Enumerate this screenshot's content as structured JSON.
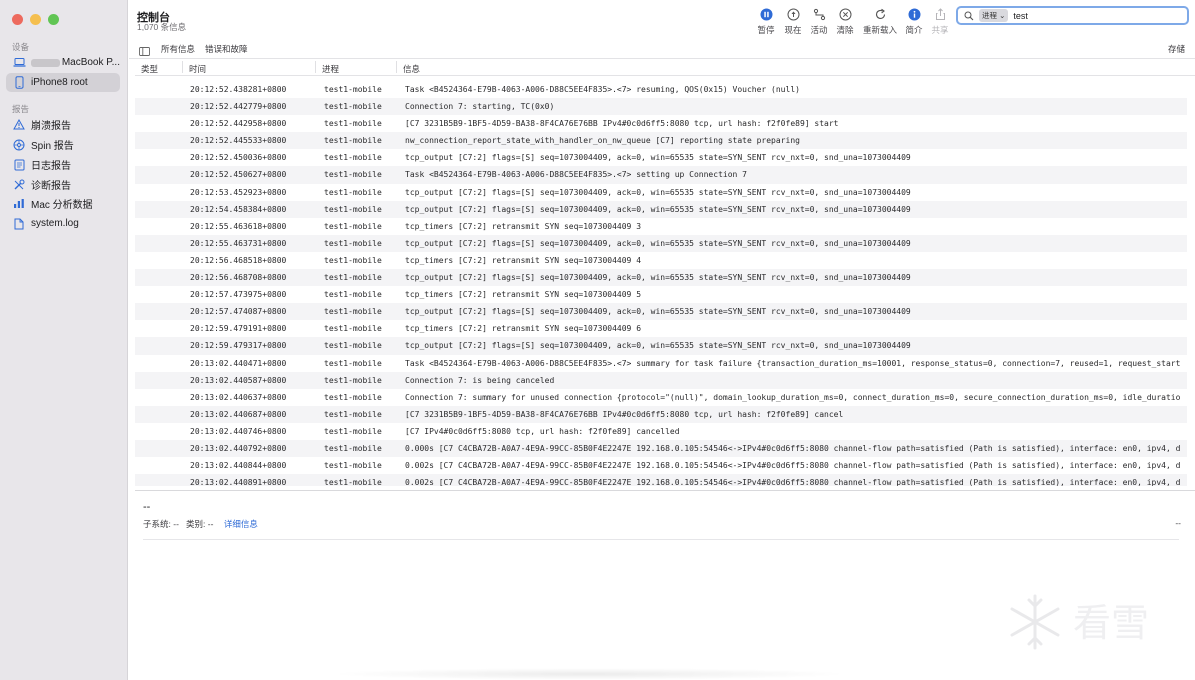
{
  "window": {
    "title": "控制台",
    "subtitle": "1,070 条信息"
  },
  "sidebar": {
    "devices_heading": "设备",
    "devices": [
      {
        "label": "MacBook P...",
        "icon": "laptop-icon"
      },
      {
        "label": "iPhone8 root",
        "icon": "iphone-icon",
        "selected": true
      }
    ],
    "reports_heading": "报告",
    "reports": [
      {
        "label": "崩溃报告",
        "icon": "warning-icon"
      },
      {
        "label": "Spin 报告",
        "icon": "spin-icon"
      },
      {
        "label": "日志报告",
        "icon": "log-report-icon"
      },
      {
        "label": "诊断报告",
        "icon": "tools-icon"
      },
      {
        "label": "Mac 分析数据",
        "icon": "analytics-icon"
      },
      {
        "label": "system.log",
        "icon": "document-icon"
      }
    ]
  },
  "toolbar": {
    "pause": "暂停",
    "now": "现在",
    "activity": "活动",
    "clear": "清除",
    "reload": "重新载入",
    "info": "简介",
    "share": "共享"
  },
  "search": {
    "token": "进程",
    "value": "test"
  },
  "filterbar": {
    "all": "所有信息",
    "errors": "错误和故障",
    "save": "存储"
  },
  "columns": {
    "type": "类型",
    "time": "时间",
    "process": "进程",
    "message": "信息"
  },
  "logs": [
    {
      "time": "20:12:52.438281+0800",
      "process": "test1-mobile",
      "message": "Task <B4524364-E79B-4063-A006-D88C5EE4F835>.<7> resuming, QOS(0x15) Voucher (null)"
    },
    {
      "time": "20:12:52.442779+0800",
      "process": "test1-mobile",
      "message": "Connection 7: starting, TC(0x0)"
    },
    {
      "time": "20:12:52.442958+0800",
      "process": "test1-mobile",
      "message": "[C7 3231B5B9-1BF5-4D59-BA38-8F4CA76E76BB IPv4#0c0d6ff5:8080 tcp, url hash: f2f0fe89] start"
    },
    {
      "time": "20:12:52.445533+0800",
      "process": "test1-mobile",
      "message": "nw_connection_report_state_with_handler_on_nw_queue [C7] reporting state preparing"
    },
    {
      "time": "20:12:52.450036+0800",
      "process": "test1-mobile",
      "message": "tcp_output [C7:2] flags=[S] seq=1073004409, ack=0, win=65535 state=SYN_SENT rcv_nxt=0, snd_una=1073004409"
    },
    {
      "time": "20:12:52.450627+0800",
      "process": "test1-mobile",
      "message": "Task <B4524364-E79B-4063-A006-D88C5EE4F835>.<7> setting up Connection 7"
    },
    {
      "time": "20:12:53.452923+0800",
      "process": "test1-mobile",
      "message": "tcp_output [C7:2] flags=[S] seq=1073004409, ack=0, win=65535 state=SYN_SENT rcv_nxt=0, snd_una=1073004409"
    },
    {
      "time": "20:12:54.458384+0800",
      "process": "test1-mobile",
      "message": "tcp_output [C7:2] flags=[S] seq=1073004409, ack=0, win=65535 state=SYN_SENT rcv_nxt=0, snd_una=1073004409"
    },
    {
      "time": "20:12:55.463618+0800",
      "process": "test1-mobile",
      "message": "tcp_timers [C7:2] retransmit SYN seq=1073004409 3"
    },
    {
      "time": "20:12:55.463731+0800",
      "process": "test1-mobile",
      "message": "tcp_output [C7:2] flags=[S] seq=1073004409, ack=0, win=65535 state=SYN_SENT rcv_nxt=0, snd_una=1073004409"
    },
    {
      "time": "20:12:56.468518+0800",
      "process": "test1-mobile",
      "message": "tcp_timers [C7:2] retransmit SYN seq=1073004409 4"
    },
    {
      "time": "20:12:56.468708+0800",
      "process": "test1-mobile",
      "message": "tcp_output [C7:2] flags=[S] seq=1073004409, ack=0, win=65535 state=SYN_SENT rcv_nxt=0, snd_una=1073004409"
    },
    {
      "time": "20:12:57.473975+0800",
      "process": "test1-mobile",
      "message": "tcp_timers [C7:2] retransmit SYN seq=1073004409 5"
    },
    {
      "time": "20:12:57.474087+0800",
      "process": "test1-mobile",
      "message": "tcp_output [C7:2] flags=[S] seq=1073004409, ack=0, win=65535 state=SYN_SENT rcv_nxt=0, snd_una=1073004409"
    },
    {
      "time": "20:12:59.479191+0800",
      "process": "test1-mobile",
      "message": "tcp_timers [C7:2] retransmit SYN seq=1073004409 6"
    },
    {
      "time": "20:12:59.479317+0800",
      "process": "test1-mobile",
      "message": "tcp_output [C7:2] flags=[S] seq=1073004409, ack=0, win=65535 state=SYN_SENT rcv_nxt=0, snd_una=1073004409"
    },
    {
      "time": "20:13:02.440471+0800",
      "process": "test1-mobile",
      "message": "Task <B4524364-E79B-4063-A006-D88C5EE4F835>.<7> summary for task failure {transaction_duration_ms=10001, response_status=0, connection=7, reused=1, request_start"
    },
    {
      "time": "20:13:02.440587+0800",
      "process": "test1-mobile",
      "message": "Connection 7: is being canceled"
    },
    {
      "time": "20:13:02.440637+0800",
      "process": "test1-mobile",
      "message": "Connection 7: summary for unused connection {protocol=\"(null)\", domain_lookup_duration_ms=0, connect_duration_ms=0, secure_connection_duration_ms=0, idle_duratio"
    },
    {
      "time": "20:13:02.440687+0800",
      "process": "test1-mobile",
      "message": "[C7 3231B5B9-1BF5-4D59-BA38-8F4CA76E76BB IPv4#0c0d6ff5:8080 tcp, url hash: f2f0fe89] cancel"
    },
    {
      "time": "20:13:02.440746+0800",
      "process": "test1-mobile",
      "message": "[C7 IPv4#0c0d6ff5:8080 tcp, url hash: f2f0fe89] cancelled"
    },
    {
      "time": "20:13:02.440792+0800",
      "process": "test1-mobile",
      "message": "0.000s [C7 C4CBA72B-A0A7-4E9A-99CC-85B0F4E2247E 192.168.0.105:54546<->IPv4#0c0d6ff5:8080 channel-flow path=satisfied (Path is satisfied), interface: en0, ipv4, d"
    },
    {
      "time": "20:13:02.440844+0800",
      "process": "test1-mobile",
      "message": "0.002s [C7 C4CBA72B-A0A7-4E9A-99CC-85B0F4E2247E 192.168.0.105:54546<->IPv4#0c0d6ff5:8080 channel-flow path=satisfied (Path is satisfied), interface: en0, ipv4, d"
    },
    {
      "time": "20:13:02.440891+0800",
      "process": "test1-mobile",
      "message": "0.002s [C7 C4CBA72B-A0A7-4E9A-99CC-85B0F4E2247E 192.168.0.105:54546<->IPv4#0c0d6ff5:8080 channel-flow path=satisfied (Path is satisfied), interface: en0, ipv4, d"
    }
  ],
  "detail": {
    "placeholder": "--",
    "subsystem_label": "子系统:",
    "subsystem_value": "--",
    "category_label": "类别:",
    "category_value": "--",
    "details_link": "详细信息",
    "right_value": "--"
  },
  "watermark": {
    "text": "看雪"
  },
  "colors": {
    "accent": "#2f6bd6",
    "sidebar_bg": "#e8e6ea",
    "search_focus": "#7ea9e8"
  }
}
